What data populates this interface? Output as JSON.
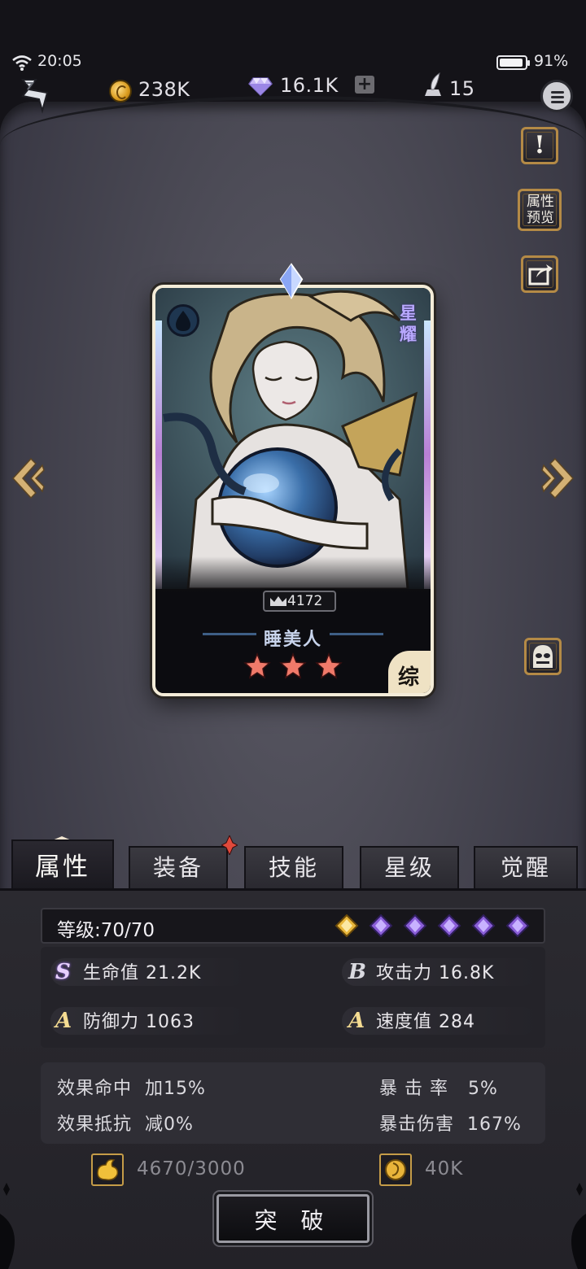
{
  "status_bar": {
    "time": "20:05",
    "battery": "91%"
  },
  "resources": {
    "gold": "238K",
    "gems": "16.1K",
    "gem_add": "+",
    "quills": "15"
  },
  "side_buttons": {
    "preview_label": "属性预览"
  },
  "card": {
    "rarity": "星耀",
    "power": "4172",
    "name": "睡美人",
    "stars": 3,
    "class": "综"
  },
  "tabs": [
    "属性",
    "装备",
    "技能",
    "星级",
    "觉醒"
  ],
  "level": {
    "text": "等级:70/70",
    "gems_total": 6,
    "gems_gold": 1
  },
  "stats": {
    "hp": {
      "grade": "S",
      "label": "生命值 21.2K"
    },
    "atk": {
      "grade": "B",
      "label": "攻击力 16.8K"
    },
    "def": {
      "grade": "A",
      "label": "防御力 1063"
    },
    "spd": {
      "grade": "A",
      "label": "速度值 284"
    }
  },
  "sub_stats": {
    "effect_hit": "效果命中  加15%",
    "crit_rate": "暴 击 率   5%",
    "effect_res": "效果抵抗  减0%",
    "crit_dmg": "暴击伤害  167%"
  },
  "breakthrough": {
    "material": "4670/3000",
    "coins": "40K",
    "button": "突 破"
  },
  "colors": {
    "accent_gold": "#c59c48",
    "panel": "#4a4954",
    "rarity_purple": "#b9a9ff"
  }
}
